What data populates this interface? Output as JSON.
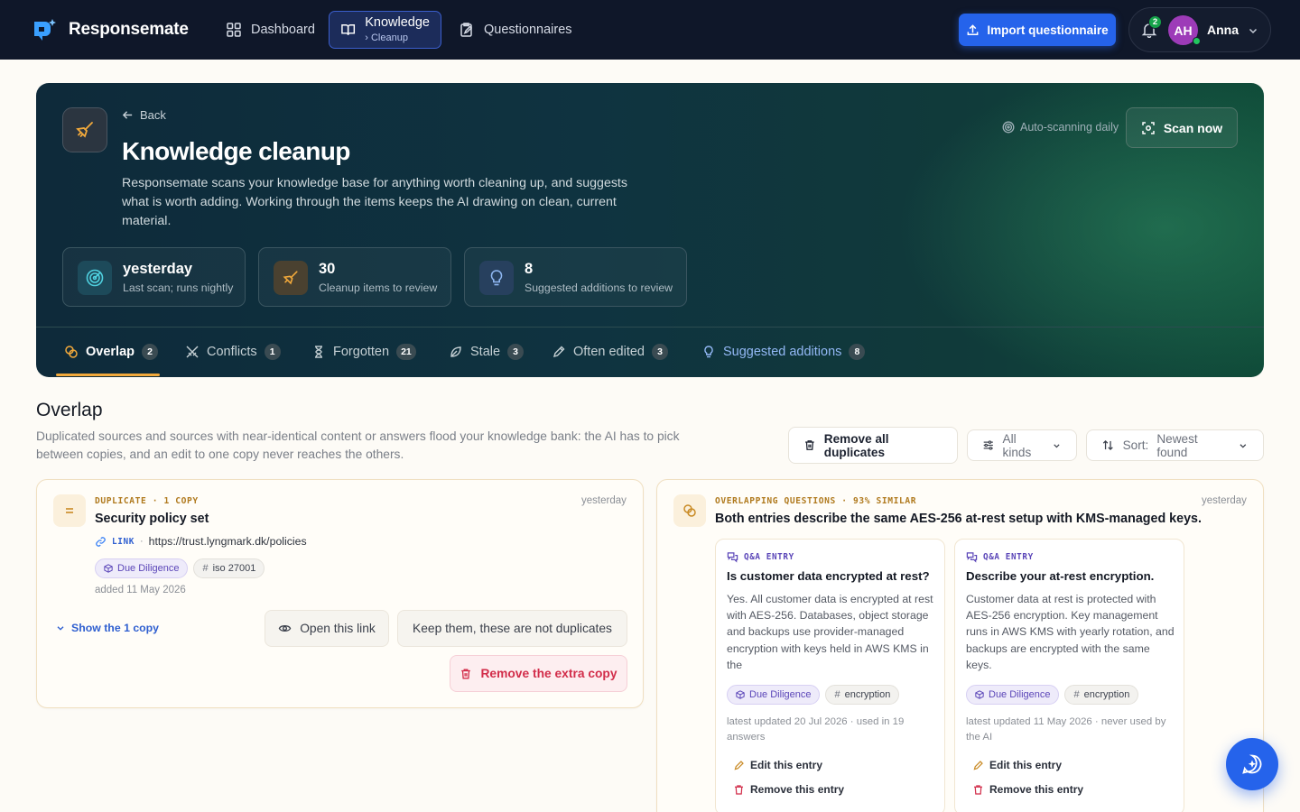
{
  "nav": {
    "brand": "Responsemate",
    "dashboard": "Dashboard",
    "knowledge": "Knowledge",
    "knowledge_sub": "Cleanup",
    "questionnaires": "Questionnaires",
    "import": "Import questionnaire",
    "notifications_count": "2",
    "avatar_initials": "AH",
    "user_name": "Anna"
  },
  "hero": {
    "back": "Back",
    "title": "Knowledge cleanup",
    "description": "Responsemate scans your knowledge base for anything worth cleaning up, and suggests what is worth adding. Working through the items keeps the AI drawing on clean, current material.",
    "auto_scan": "Auto-scanning daily",
    "scan_button": "Scan now",
    "stats": [
      {
        "value": "yesterday",
        "label": "Last scan; runs nightly"
      },
      {
        "value": "30",
        "label": "Cleanup items to review"
      },
      {
        "value": "8",
        "label": "Suggested additions to review"
      }
    ],
    "tabs": [
      {
        "label": "Overlap",
        "count": "2"
      },
      {
        "label": "Conflicts",
        "count": "1"
      },
      {
        "label": "Forgotten",
        "count": "21"
      },
      {
        "label": "Stale",
        "count": "3"
      },
      {
        "label": "Often edited",
        "count": "3"
      },
      {
        "label": "Suggested additions",
        "count": "8"
      }
    ]
  },
  "section": {
    "title": "Overlap",
    "description": "Duplicated sources and sources with near-identical content or answers flood your knowledge bank: the AI has to pick between copies, and an edit to one copy never reaches the others.",
    "remove_all": "Remove all duplicates",
    "kinds": "All kinds",
    "sort_label": "Sort:",
    "sort_value": "Newest found"
  },
  "card_duplicate": {
    "kicker": "DUPLICATE · 1 COPY",
    "time": "yesterday",
    "title": "Security policy set",
    "link_kind": "LINK",
    "link_sep": "·",
    "url": "https://trust.lyngmark.dk/policies",
    "chip_category": "Due Diligence",
    "chip_tag": "iso 27001",
    "added": "added 11 May 2026",
    "show_copy": "Show the 1 copy",
    "open_link": "Open this link",
    "keep": "Keep them, these are not duplicates",
    "remove_extra": "Remove the extra copy"
  },
  "card_overlap": {
    "kicker": "OVERLAPPING QUESTIONS · 93% SIMILAR",
    "time": "yesterday",
    "title": "Both entries describe the same AES-256 at-rest setup with KMS-managed keys.",
    "entries": [
      {
        "kicker": "Q&A ENTRY",
        "question": "Is customer data encrypted at rest?",
        "answer": "Yes. All customer data is encrypted at rest with AES-256. Databases, object storage and backups use provider-managed encryption with keys held in AWS KMS in the",
        "chip_category": "Due Diligence",
        "chip_tag": "encryption",
        "meta": "latest updated 20 Jul 2026 · used in 19 answers",
        "edit": "Edit this entry",
        "remove": "Remove this entry"
      },
      {
        "kicker": "Q&A ENTRY",
        "question": "Describe your at-rest encryption.",
        "answer": "Customer data at rest is protected with AES-256 encryption. Key management runs in AWS KMS with yearly rotation, and backups are encrypted with the same keys.",
        "chip_category": "Due Diligence",
        "chip_tag": "encryption",
        "meta": "latest updated 11 May 2026 · never used by the AI",
        "edit": "Edit this entry",
        "remove": "Remove this entry"
      }
    ]
  },
  "colors": {
    "nav_bg": "#0f1729",
    "accent_blue": "#2563eb",
    "tab_active_underline": "#f2a93b",
    "danger": "#d22d4a",
    "category_chip": "#5b46b8"
  }
}
